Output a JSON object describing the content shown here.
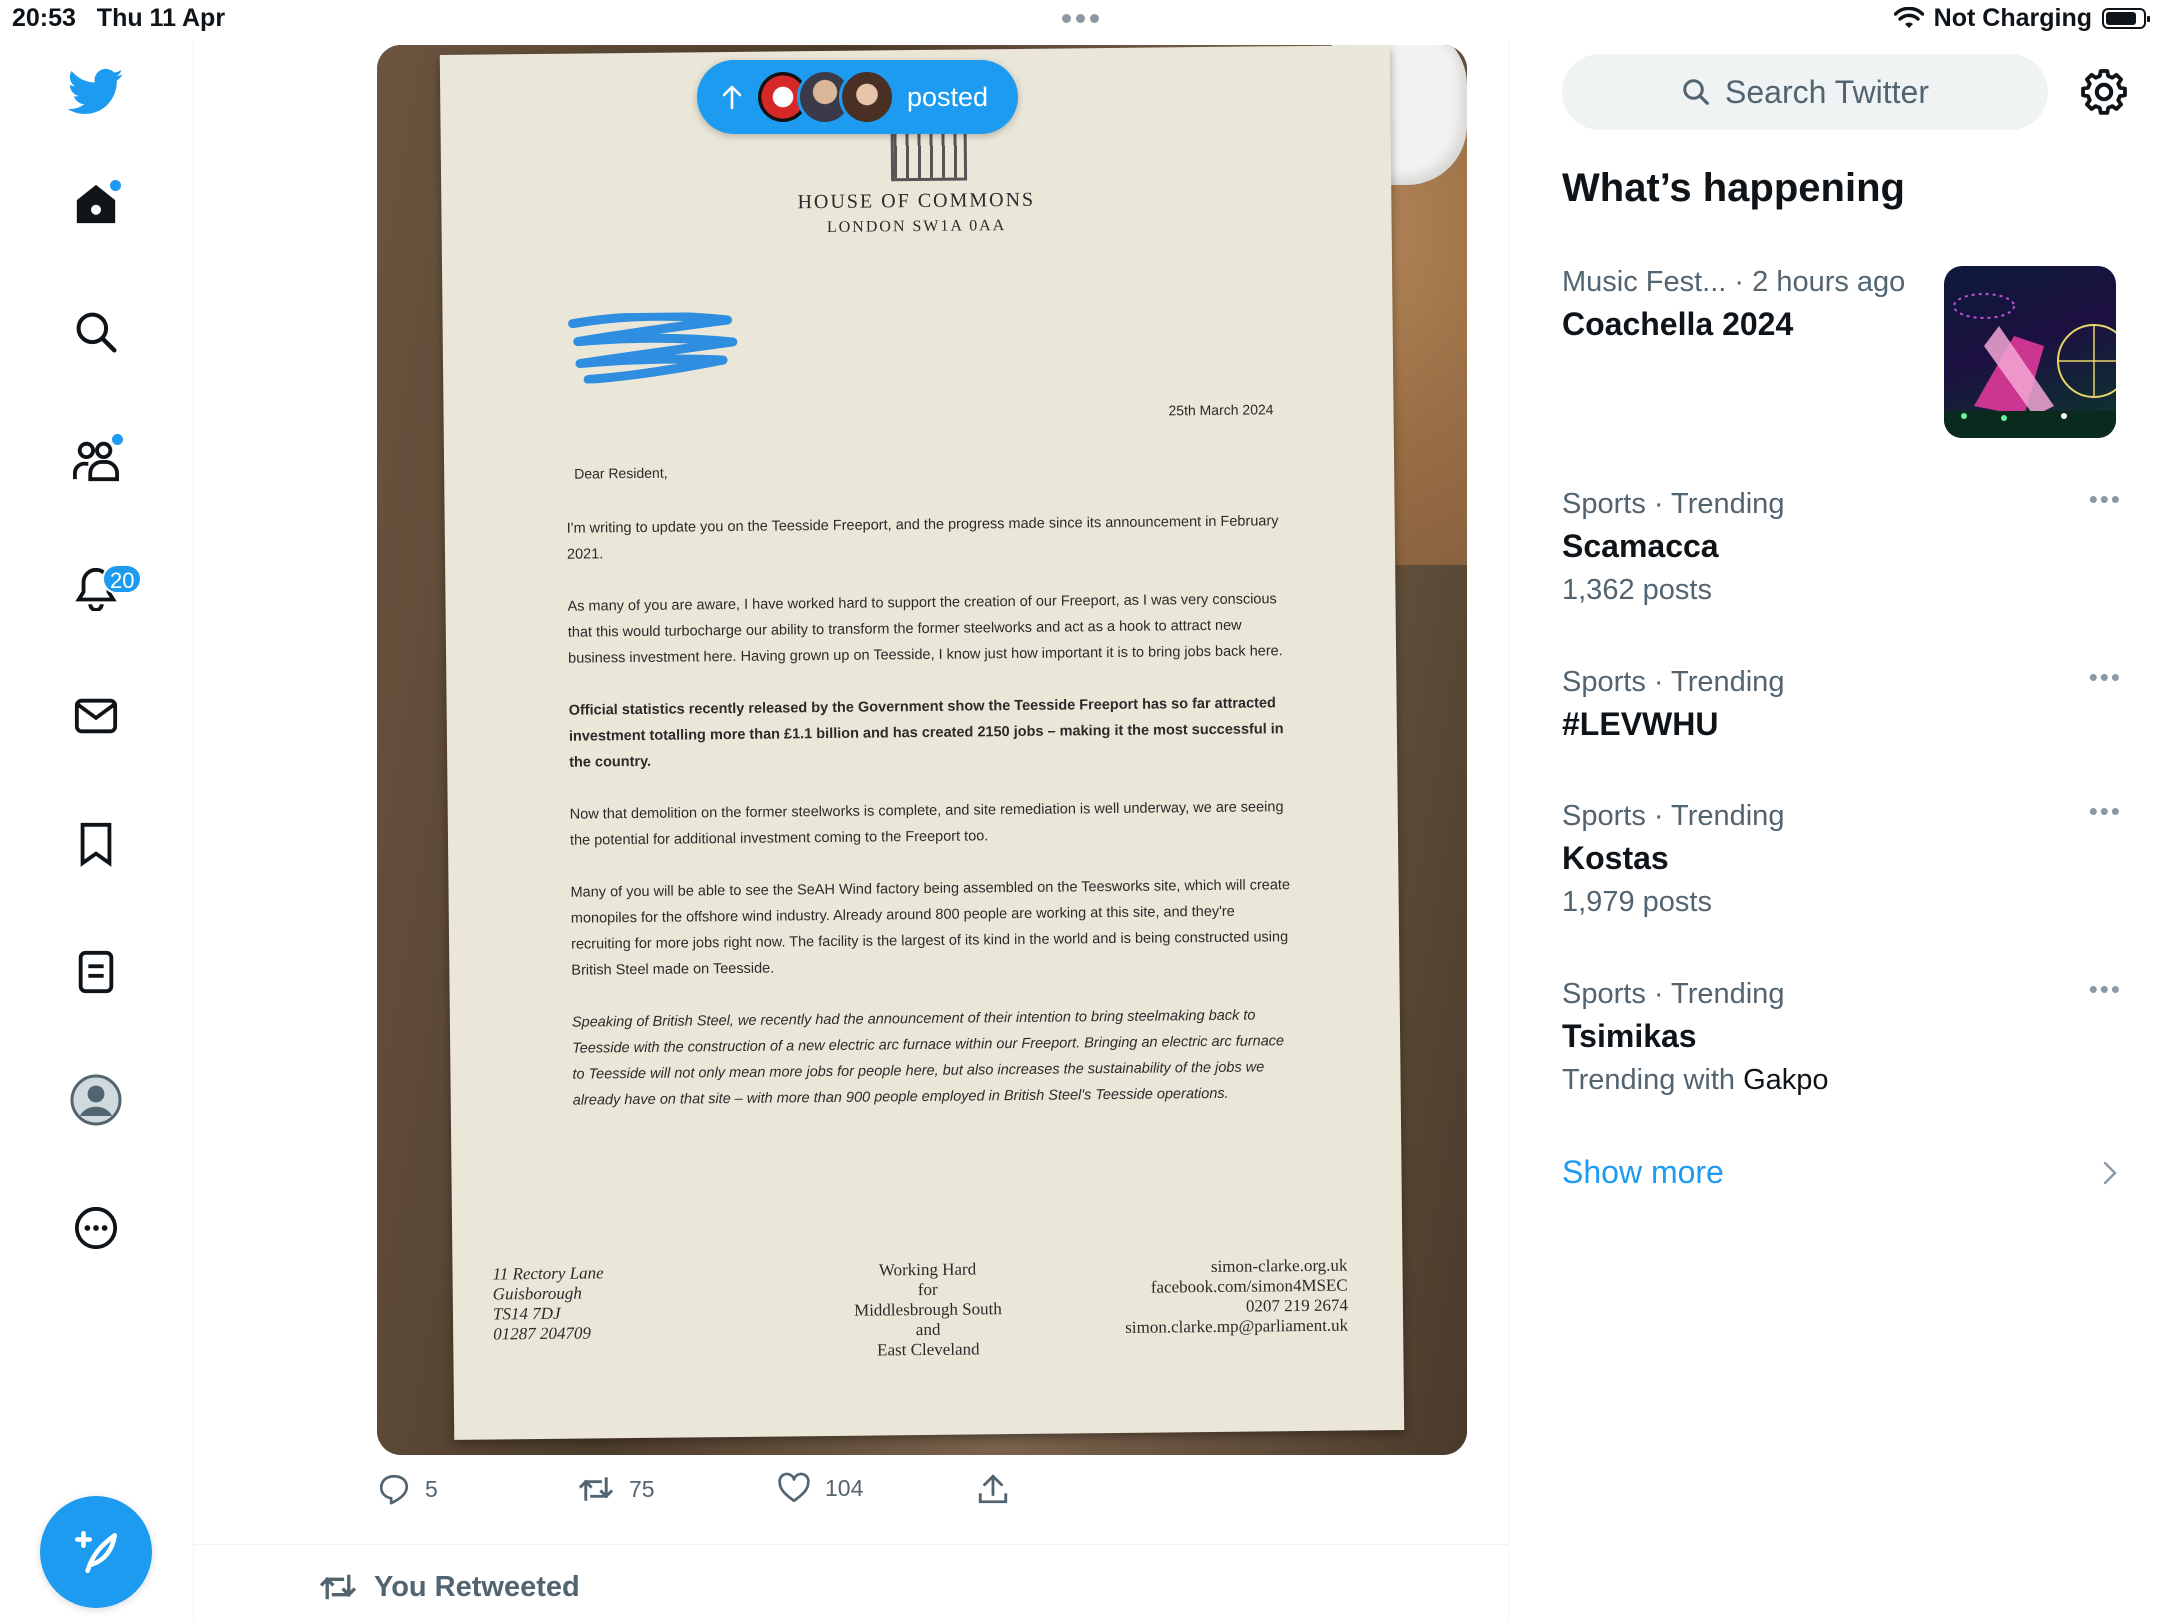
{
  "status_bar": {
    "time": "20:53",
    "date": "Thu 11 Apr",
    "battery_text": "Not Charging"
  },
  "nav": {
    "notifications_badge": "20"
  },
  "post": {
    "posted_chip": {
      "label": "posted"
    },
    "letter": {
      "header_line1": "HOUSE OF COMMONS",
      "header_line2": "LONDON SW1A 0AA",
      "date": "25th March 2024",
      "greeting": "Dear Resident,",
      "paragraphs": [
        "I'm writing to update you on the Teesside Freeport, and the progress made since its announcement in February 2021.",
        "As many of you are aware, I have worked hard to support the creation of our Freeport, as I was very conscious that this would turbocharge our ability to transform the former steelworks and act as a hook to attract new business investment here. Having grown up on Teesside, I know just how important it is to bring jobs back here.",
        "Official statistics recently released by the Government show the Teesside Freeport has so far attracted investment totalling more than £1.1 billion and has created 2150 jobs – making it the most successful in the country.",
        "Now that demolition on the former steelworks is complete, and site remediation is well underway, we are seeing the potential for additional investment coming to the Freeport too.",
        "Many of you will be able to see the SeAH Wind factory being assembled on the Teesworks site, which will create monopiles for the offshore wind industry. Already around 800 people are working at this site, and they're recruiting for more jobs right now. The facility is the largest of its kind in the world and is being constructed using British Steel made on Teesside.",
        "Speaking of British Steel, we recently had the announcement of their intention to bring steelmaking back to Teesside with the construction of a new electric arc furnace within our Freeport. Bringing an electric arc furnace to Teesside will not only mean more jobs for people here, but also increases the sustainability of the jobs we already have on that site – with more than 900 people employed in British Steel's Teesside operations."
      ],
      "footer_left": [
        "11 Rectory Lane",
        "Guisborough",
        "TS14 7DJ",
        "01287 204709"
      ],
      "footer_center": [
        "Working Hard",
        "for",
        "Middlesbrough South",
        "and",
        "East Cleveland"
      ],
      "footer_right": [
        "simon-clarke.org.uk",
        "facebook.com/simon4MSEC",
        "0207 219 2674",
        "simon.clarke.mp@parliament.uk"
      ]
    },
    "actions": {
      "replies": "5",
      "retweets": "75",
      "likes": "104"
    }
  },
  "next_post": {
    "retweet_label": "You Retweeted"
  },
  "sidebar": {
    "search_placeholder": "Search Twitter",
    "heading": "What’s happening",
    "featured": {
      "category": "Music Fest...",
      "time": "· 2 hours ago",
      "title": "Coachella 2024"
    },
    "trends": [
      {
        "meta": "Sports · Trending",
        "title": "Scamacca",
        "sub": "1,362 posts"
      },
      {
        "meta": "Sports · Trending",
        "title": "#LEVWHU",
        "sub": ""
      },
      {
        "meta": "Sports · Trending",
        "title": "Kostas",
        "sub": "1,979 posts"
      },
      {
        "meta": "Sports · Trending",
        "title": "Tsimikas",
        "sub_prefix": "Trending with",
        "sub_name": "Gakpo"
      }
    ],
    "show_more": "Show more"
  },
  "colors": {
    "accent": "#1d9bf0",
    "text": "#0f1419",
    "muted": "#536471",
    "border": "#eff3f4"
  }
}
